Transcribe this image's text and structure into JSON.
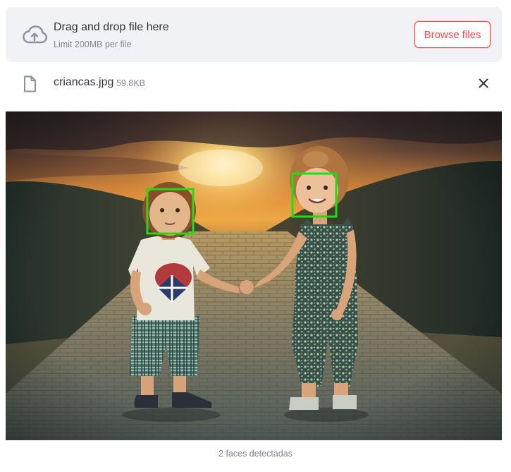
{
  "uploader": {
    "title": "Drag and drop file here",
    "limit": "Limit 200MB per file",
    "browse_label": "Browse files",
    "icon": "cloud-upload-icon"
  },
  "file": {
    "name": "criancas.jpg",
    "size": "59.8KB",
    "icon": "file-icon",
    "remove_icon": "close-icon"
  },
  "image": {
    "faces_detected": 2,
    "box_color": "#22dd11"
  },
  "caption": "2 faces detectadas",
  "colors": {
    "accent": "#ff4b4b",
    "dropzone_bg": "#f0f2f6",
    "muted_text": "#808495"
  }
}
